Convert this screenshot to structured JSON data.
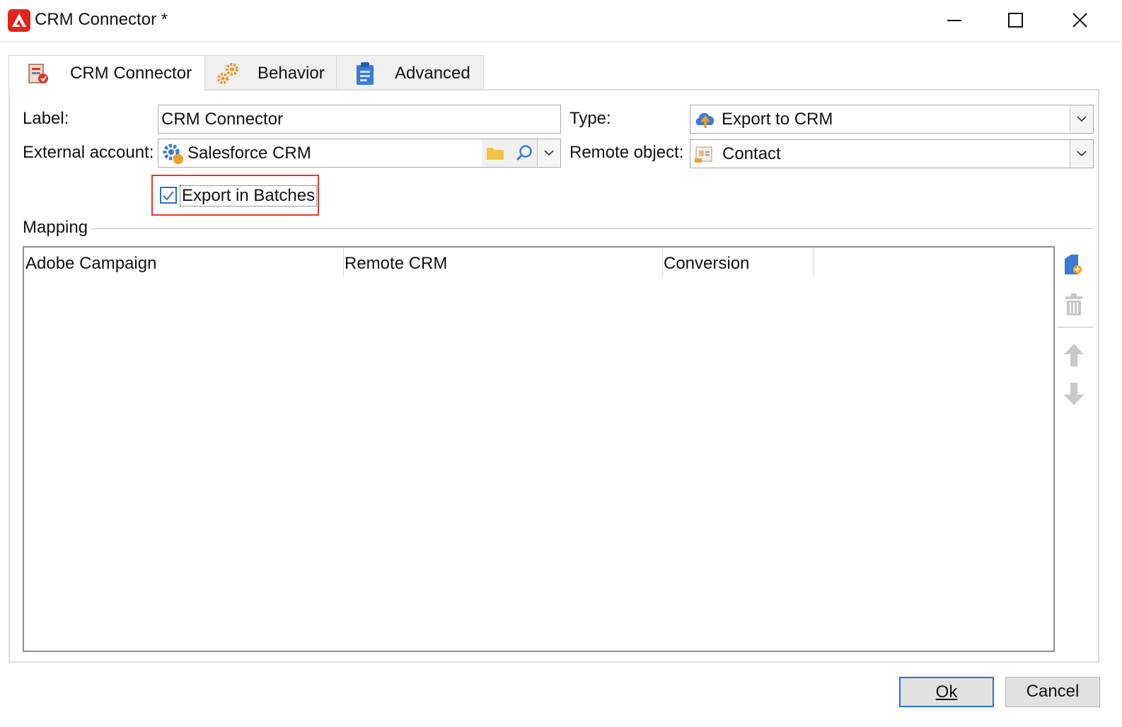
{
  "window": {
    "title": "CRM Connector *"
  },
  "tabs": [
    {
      "label": "CRM Connector",
      "icon": "crm-connector-icon",
      "active": true
    },
    {
      "label": "Behavior",
      "icon": "gears-icon",
      "active": false
    },
    {
      "label": "Advanced",
      "icon": "clipboard-icon",
      "active": false
    }
  ],
  "form": {
    "label_caption": "Label:",
    "label_value": "CRM Connector",
    "type_caption": "Type:",
    "type_value": "Export to CRM",
    "external_account_caption": "External account:",
    "external_account_value": "Salesforce CRM",
    "remote_object_caption": "Remote object:",
    "remote_object_value": "Contact",
    "export_in_batches_label": "Export in Batches",
    "export_in_batches_checked": true
  },
  "mapping": {
    "section_label": "Mapping",
    "columns": [
      "Adobe Campaign",
      "Remote CRM",
      "Conversion"
    ],
    "rows": []
  },
  "buttons": {
    "ok_label": "Ok",
    "cancel_label": "Cancel"
  },
  "colors": {
    "highlight_border": "#e8392a",
    "accent_blue": "#2a72c9",
    "adobe_red": "#e1251b"
  }
}
